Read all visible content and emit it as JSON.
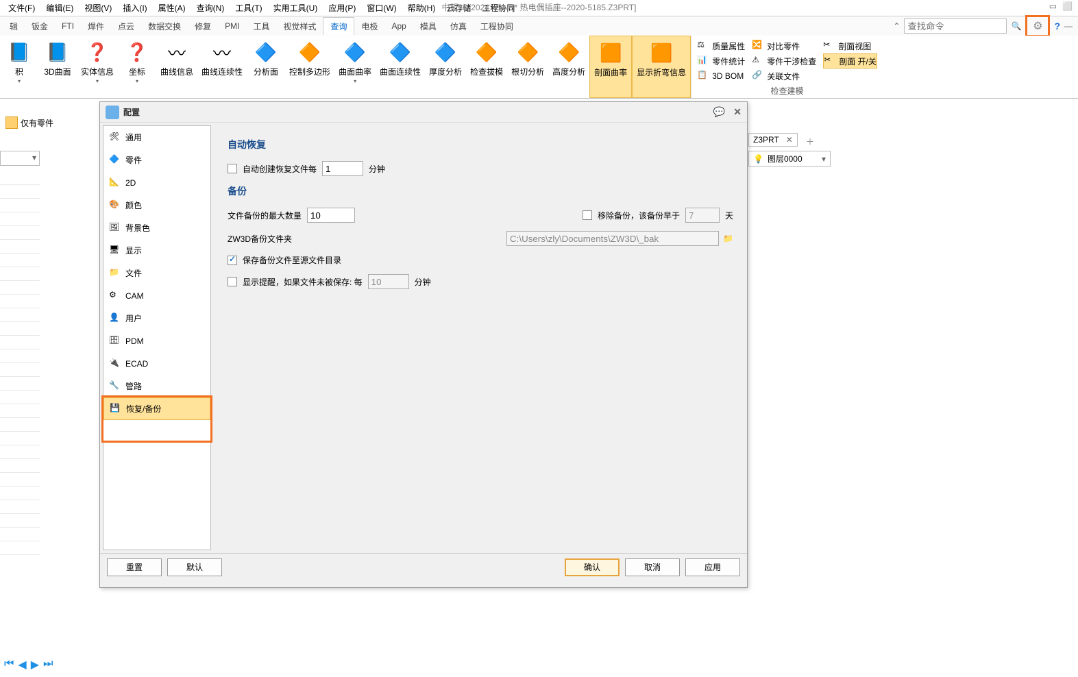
{
  "app": {
    "title": "中望3D 2024 x64 - [* 热电偶插座--2020-5185.Z3PRT]"
  },
  "menus": [
    "文件(F)",
    "编辑(E)",
    "视图(V)",
    "插入(I)",
    "属性(A)",
    "查询(N)",
    "工具(T)",
    "实用工具(U)",
    "应用(P)",
    "窗口(W)",
    "帮助(H)",
    "云存储",
    "工程协同"
  ],
  "tabs": {
    "items": [
      "辑",
      "钣金",
      "FTI",
      "焊件",
      "点云",
      "数据交换",
      "修复",
      "PMI",
      "工具",
      "视觉样式",
      "查询",
      "电极",
      "App",
      "模具",
      "仿真",
      "工程协同"
    ],
    "active": "查询"
  },
  "search_placeholder": "查找命令",
  "ribbon": {
    "buttons": [
      {
        "label": "积",
        "dd": true
      },
      {
        "label": "3D曲面"
      },
      {
        "label": "实体信息",
        "dd": true
      },
      {
        "label": "坐标",
        "dd": true
      },
      {
        "label": "曲线信息"
      },
      {
        "label": "曲线连续性"
      },
      {
        "label": "分析面"
      },
      {
        "label": "控制多边形"
      },
      {
        "label": "曲面曲率",
        "dd": true
      },
      {
        "label": "曲面连续性"
      },
      {
        "label": "厚度分析"
      },
      {
        "label": "检查拔模"
      },
      {
        "label": "根切分析"
      },
      {
        "label": "高度分析"
      },
      {
        "label": "剖面曲率",
        "active": true
      },
      {
        "label": "显示折弯信息",
        "active": true
      }
    ],
    "panel1": [
      {
        "label": "质量属性"
      },
      {
        "label": "零件统计"
      },
      {
        "label": "3D BOM"
      }
    ],
    "panel2": [
      {
        "label": "对比零件"
      },
      {
        "label": "零件干涉检查"
      },
      {
        "label": "关联文件"
      }
    ],
    "panel3": [
      {
        "label": "剖面视图"
      },
      {
        "label": "剖面 开/关",
        "active": true
      }
    ],
    "caption": "检查建模"
  },
  "partonly": "仅有零件",
  "tabRight": {
    "name": "Z3PRT"
  },
  "layer": "图层0000",
  "dialog": {
    "title": "配置",
    "nav": [
      "通用",
      "零件",
      "2D",
      "颜色",
      "背景色",
      "显示",
      "文件",
      "CAM",
      "用户",
      "PDM",
      "ECAD",
      "管路",
      "恢复/备份"
    ],
    "selected": "恢复/备份",
    "content": {
      "auto_recover_h": "自动恢复",
      "auto_create_label": "自动创建恢复文件每",
      "auto_create_val": "1",
      "minutes": "分钟",
      "backup_h": "备份",
      "max_backup_label": "文件备份的最大数量",
      "max_backup_val": "10",
      "remove_backup_label": "移除备份，该备份早于",
      "remove_backup_val": "7",
      "days": "天",
      "folder_label": "ZW3D备份文件夹",
      "folder_val": "C:\\Users\\zly\\Documents\\ZW3D\\_bak",
      "save_to_src_label": "保存备份文件至源文件目录",
      "remind_label": "显示提醒，如果文件未被保存: 每",
      "remind_val": "10"
    },
    "buttons": {
      "reset": "重置",
      "default": "默认",
      "ok": "确认",
      "cancel": "取消",
      "apply": "应用"
    }
  }
}
